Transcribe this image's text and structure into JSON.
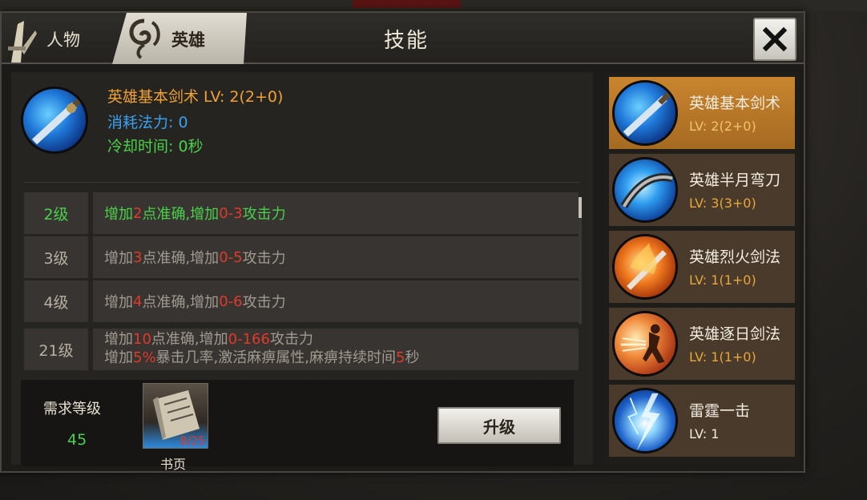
{
  "tabs": [
    {
      "label": "人物",
      "icon": "sword-icon"
    },
    {
      "label": "英雄",
      "icon": "swirl-emblem-icon",
      "active": true
    }
  ],
  "title": "技能",
  "close_icon": "close-icon",
  "selected_skill": {
    "name_line": "英雄基本剑术 LV: 2(2+0)",
    "mana_line": "消耗法力: 0",
    "cooldown_line": "冷却时间: 0秒",
    "icon": "blue-sword-skill-icon"
  },
  "levels": [
    {
      "level": "2级",
      "parts": [
        "增加",
        "2",
        "点准确,增加",
        "0-3",
        "攻击力"
      ],
      "active": true
    },
    {
      "level": "3级",
      "parts": [
        "增加",
        "3",
        "点准确,增加",
        "0-5",
        "攻击力"
      ]
    },
    {
      "level": "4级",
      "parts": [
        "增加",
        "4",
        "点准确,增加",
        "0-6",
        "攻击力"
      ]
    }
  ],
  "level21": {
    "level": "21级",
    "line1": [
      "增加",
      "10",
      "点准确,增加",
      "0-166",
      "攻击力"
    ],
    "line2": [
      "增加",
      "5%",
      "暴击几率,激活麻痹属性,麻痹持续时间",
      "5",
      "秒"
    ]
  },
  "requirement": {
    "label": "需求等级",
    "value": "45",
    "book_label": "书页",
    "book_count": "8/25",
    "upgrade_label": "升级"
  },
  "skills": [
    {
      "name": "英雄基本剑术",
      "lv": "LV: 2(2+0)",
      "icon": "blue-sword-skill-icon",
      "selected": true
    },
    {
      "name": "英雄半月弯刀",
      "lv": "LV: 3(3+0)",
      "icon": "crescent-blade-skill-icon"
    },
    {
      "name": "英雄烈火剑法",
      "lv": "LV: 1(1+0)",
      "icon": "fire-sword-skill-icon"
    },
    {
      "name": "英雄逐日剑法",
      "lv": "LV: 1(1+0)",
      "icon": "sun-chase-sword-skill-icon"
    },
    {
      "name": "雷霆一击",
      "lv": "LV: 1",
      "icon": "thunder-strike-skill-icon"
    }
  ],
  "colors": {
    "level_green": "#4ad04a",
    "value_red": "#e03a2a",
    "name_orange": "#f0a234",
    "mana_blue": "#3aa0f0",
    "selected_item": "#c9852e"
  }
}
